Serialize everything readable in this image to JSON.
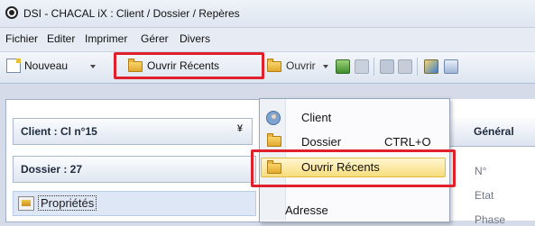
{
  "window": {
    "title": "DSI - CHACAL iX : Client / Dossier / Repères"
  },
  "menu": [
    "Fichier",
    "Editer",
    "Imprimer",
    "Gérer",
    "Divers"
  ],
  "toolbar": {
    "nouveau_label": "Nouveau",
    "ouvrir_recents_label": "Ouvrir Récents",
    "ouvrir_label": "Ouvrir"
  },
  "left_panel": {
    "client_header": "Client : Cl n°15",
    "dossier_header": "Dossier : 27",
    "proprietes_label": "Propriétés",
    "collapse_glyph": "¥"
  },
  "right_panel": {
    "header": "Général",
    "fields": [
      "N°",
      "Etat",
      "Phase"
    ]
  },
  "dropdown": {
    "items": [
      {
        "label": "Client",
        "shortcut": ""
      },
      {
        "label": "Dossier",
        "shortcut": "CTRL+O"
      },
      {
        "label": "Ouvrir Récents",
        "shortcut": ""
      }
    ],
    "below_item": "Adresse"
  },
  "colors": {
    "highlight_border": "#e0202a",
    "menu_highlight": "#f7dd7c"
  }
}
